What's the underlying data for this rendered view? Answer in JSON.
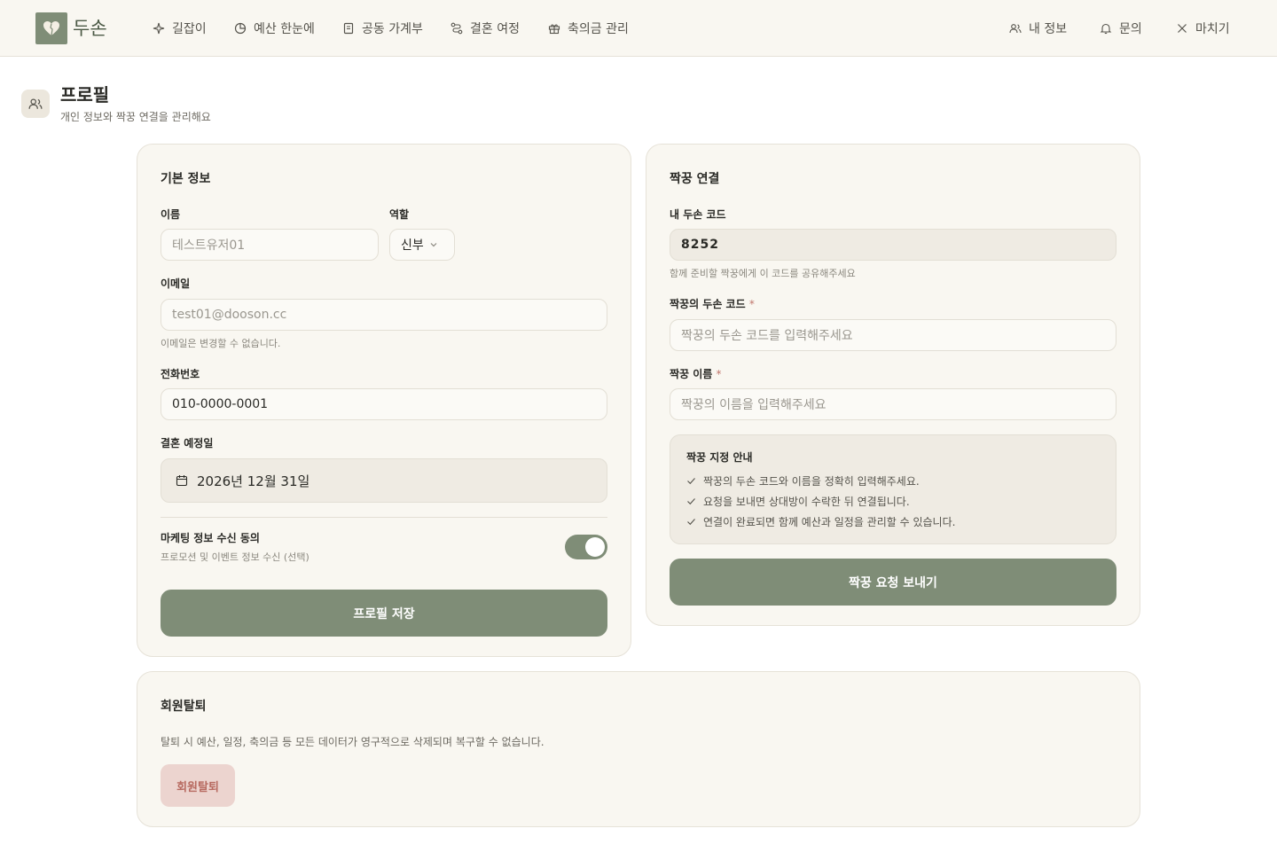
{
  "header": {
    "logo_text": "두손",
    "nav": [
      {
        "label": "길잡이",
        "icon": "sparkle-icon"
      },
      {
        "label": "예산 한눈에",
        "icon": "pie-chart-icon"
      },
      {
        "label": "공동 가계부",
        "icon": "ledger-icon"
      },
      {
        "label": "결혼 여정",
        "icon": "route-icon"
      },
      {
        "label": "축의금 관리",
        "icon": "gift-icon"
      }
    ],
    "right_nav": [
      {
        "label": "내 정보",
        "icon": "users-icon"
      },
      {
        "label": "문의",
        "icon": "bell-icon"
      },
      {
        "label": "마치기",
        "icon": "close-icon"
      }
    ]
  },
  "page": {
    "title": "프로필",
    "subtitle": "개인 정보와 짝꿍 연결을 관리해요"
  },
  "basic_info": {
    "title": "기본 정보",
    "name_label": "이름",
    "name_placeholder": "테스트유저01",
    "role_label": "역할",
    "role_value": "신부",
    "email_label": "이메일",
    "email_value": "test01@dooson.cc",
    "email_hint": "이메일은 변경할 수 없습니다.",
    "phone_label": "전화번호",
    "phone_value": "010-0000-0001",
    "wedding_label": "결혼 예정일",
    "wedding_value": "2026년 12월 31일",
    "marketing_title": "마케팅 정보 수신 동의",
    "marketing_sub": "프로모션 및 이벤트 정보 수신 (선택)",
    "marketing_on": true,
    "save_label": "프로필 저장"
  },
  "partner": {
    "title": "짝꿍 연결",
    "my_code_label": "내 두손 코드",
    "my_code_value": "8252",
    "my_code_hint": "함께 준비할 짝꿍에게 이 코드를 공유해주세요",
    "partner_code_label": "짝꿍의 두손 코드",
    "partner_code_placeholder": "짝꿍의 두손 코드를 입력해주세요",
    "partner_name_label": "짝꿍 이름",
    "partner_name_placeholder": "짝꿍의 이름을 입력해주세요",
    "required_mark": "*",
    "guide_title": "짝꿍 지정 안내",
    "guide_items": [
      "짝꿍의 두손 코드와 이름을 정확히 입력해주세요.",
      "요청을 보내면 상대방이 수락한 뒤 연결됩니다.",
      "연결이 완료되면 함께 예산과 일정을 관리할 수 있습니다."
    ],
    "send_label": "짝꿍 요청 보내기"
  },
  "withdraw": {
    "title": "회원탈퇴",
    "description": "탈퇴 시 예산, 일정, 축의금 등 모든 데이터가 영구적으로 삭제되며 복구할 수 없습니다.",
    "button_label": "회원탈퇴"
  },
  "colors": {
    "accent": "#7f8d77",
    "card_bg": "#f9f7f1",
    "danger_bg": "#ecd4cf",
    "danger_text": "#b76a60"
  }
}
